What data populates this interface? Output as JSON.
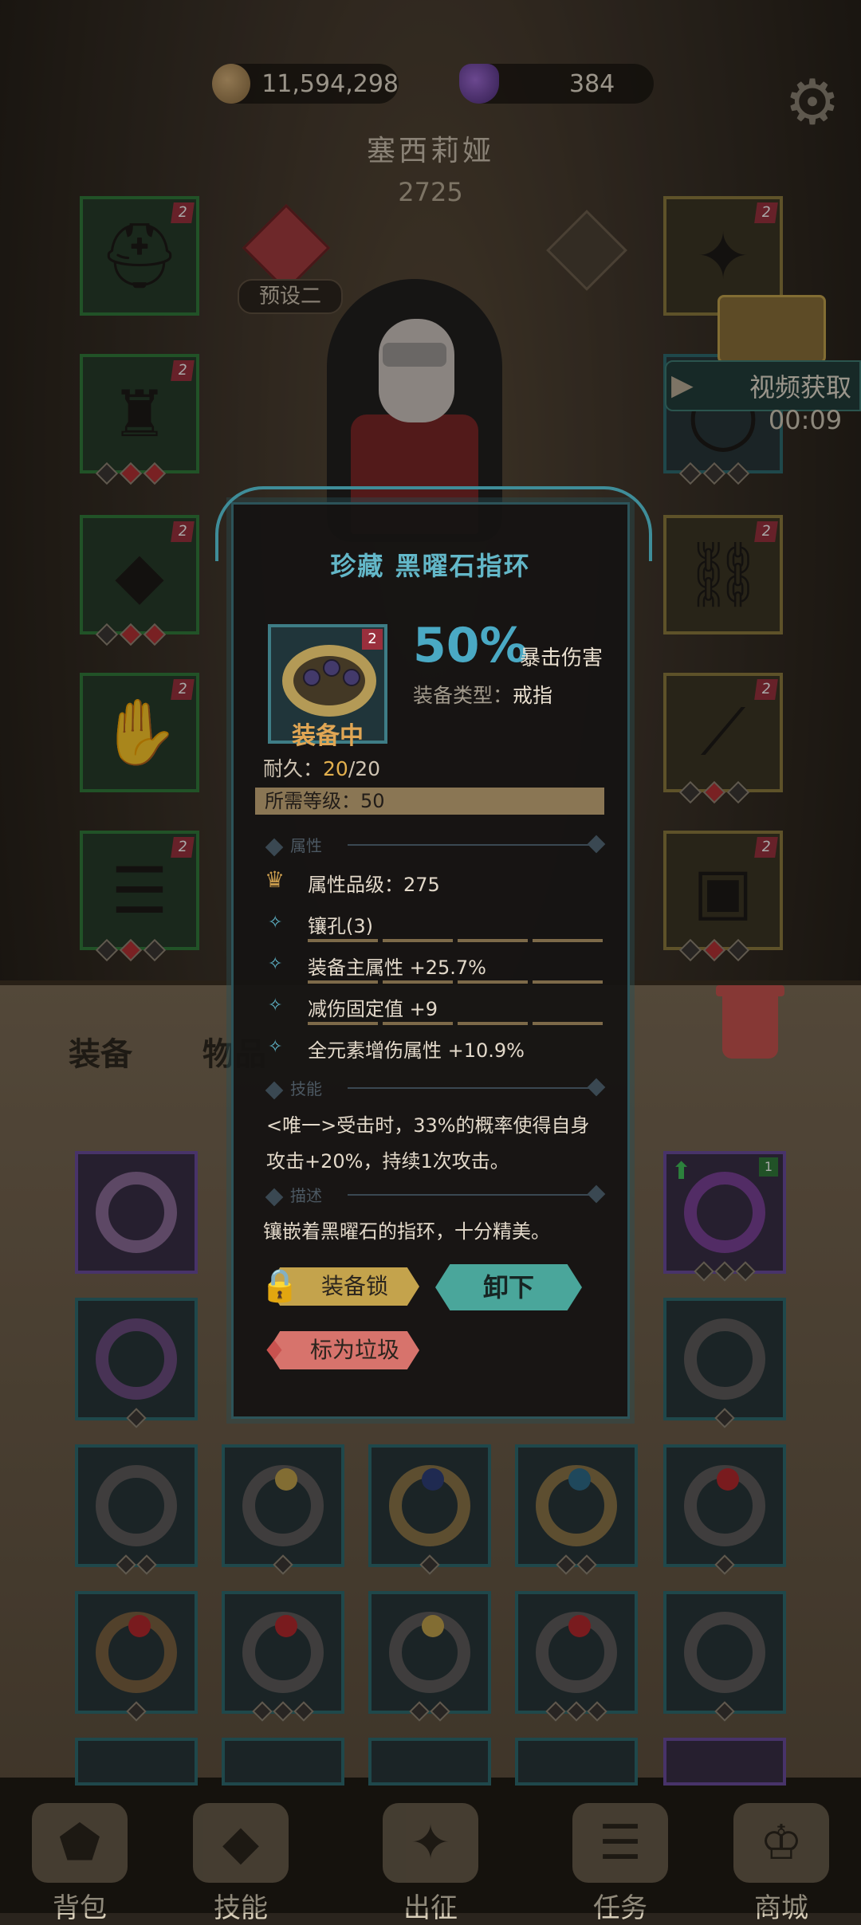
{
  "currency": {
    "gold": "11,594,298",
    "gems": "384"
  },
  "hero": {
    "name": "塞西莉娅",
    "power": "2725",
    "preset": "预设二"
  },
  "video_reward": {
    "label": "视频获取",
    "timer": "00:09"
  },
  "slot_level_badge": "2",
  "inventory_level_badge": "1",
  "tabs": {
    "equipment": "装备",
    "items": "物品"
  },
  "popup": {
    "title": "珍藏 黑曜石指环",
    "item_level": "2",
    "equipped_label": "装备中",
    "main_value": "50%",
    "main_stat": "暴击伤害",
    "type_label": "装备类型：",
    "type_value": "戒指",
    "durability_label": "耐久：",
    "durability_current": "20",
    "durability_max": "/20",
    "required_level": "所需等级：50",
    "section_attrs": "属性",
    "attr_grade": "属性品级：275",
    "attributes": [
      "镶孔(3)",
      "装备主属性 +25.7%",
      "减伤固定值 +9",
      "全元素增伤属性 +10.9%"
    ],
    "section_skill": "技能",
    "skill_line1": "<唯一>受击时，33%的概率使得自身",
    "skill_line2": "攻击+20%，持续1次攻击。",
    "section_desc": "描述",
    "description": "镶嵌着黑曜石的指环，十分精美。",
    "btn_lock": "装备锁",
    "btn_unequip": "卸下",
    "btn_trash": "标为垃圾"
  },
  "nav": {
    "bag": "背包",
    "skills": "技能",
    "expedition": "出征",
    "quests": "任务",
    "shop": "商城"
  },
  "icons": {
    "gold": "coin-icon",
    "gems": "purple-crystal-icon",
    "settings": "gear-icon"
  },
  "colors": {
    "accent_teal": "#4aa9c4",
    "equipped_orange": "#e0a654",
    "unequip_green": "#4aa69b",
    "trash_red": "#d7736c",
    "lock_gold": "#c4a34c"
  }
}
